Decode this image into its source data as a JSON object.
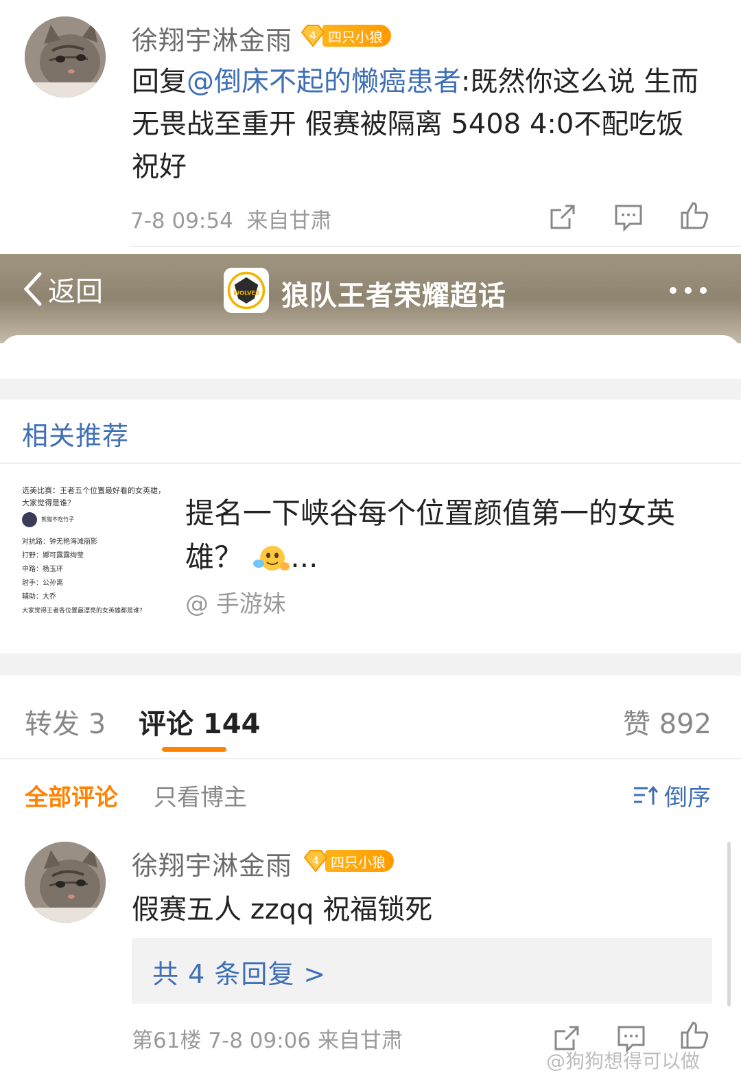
{
  "post": {
    "username": "徐翔宇淋金雨",
    "badge_level": "4",
    "badge_label": "四只小狼",
    "reply_prefix": "回复",
    "mention": "@倒床不起的懒癌患者",
    "body": ":既然你这么说  生而无畏战至重开  假赛被隔离 5408 4:0不配吃饭 祝好",
    "time": "7-8 09:54",
    "source": "来自甘肃"
  },
  "topbar": {
    "back_label": "返回",
    "topic_title": "狼队王者荣耀超话",
    "logo_text": "WOLVES"
  },
  "recommend": {
    "section_title": "相关推荐",
    "thumb_lines": [
      "选美比赛：王者五个位置最好看的女英雄，大家觉得是谁？",
      "熊猫不吃竹子",
      "对抗路：钟无艳海滩丽影",
      "打野：娜可露露绚莹",
      "中路：杨玉环",
      "射手：公孙离",
      "辅助：大乔",
      "大家觉得王者各位置最漂亮的女英雄都是谁?"
    ],
    "title": "提名一下峡谷每个位置颜值第一的女英雄？",
    "ellipsis": "...",
    "author": "@ 手游妹"
  },
  "tabs": {
    "repost": "转发 3",
    "comment": "评论 144",
    "like": "赞 892"
  },
  "filters": {
    "all": "全部评论",
    "owner_only": "只看博主",
    "sort": "倒序"
  },
  "comment": {
    "username": "徐翔宇淋金雨",
    "badge_level": "4",
    "badge_label": "四只小狼",
    "text": "假赛五人 zzqq 祝福锁死",
    "replies": "共 4 条回复 >",
    "floor_meta": "第61楼 7-8 09:06 来自甘肃"
  },
  "watermark": "@狗狗想得可以做"
}
